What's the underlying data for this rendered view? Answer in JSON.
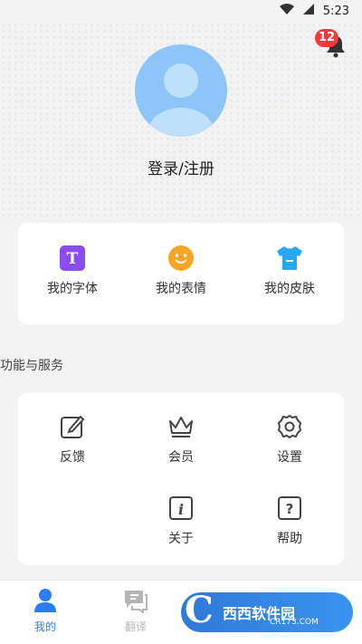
{
  "status_bar": {
    "time": "5:23"
  },
  "header": {
    "notification_count": "12",
    "login_label": "登录/注册"
  },
  "quick_tiles": [
    {
      "label": "我的字体",
      "icon": "font-t-icon",
      "color": "#8b4df2"
    },
    {
      "label": "我的表情",
      "icon": "smiley-icon",
      "color": "#f6a623"
    },
    {
      "label": "我的皮肤",
      "icon": "tshirt-icon",
      "color": "#2aa8f5"
    }
  ],
  "services": {
    "title": "功能与服务",
    "items": [
      {
        "label": "反馈",
        "icon": "edit-icon"
      },
      {
        "label": "会员",
        "icon": "crown-icon"
      },
      {
        "label": "设置",
        "icon": "gear-icon"
      },
      {
        "label": "关于",
        "icon": "info-icon"
      },
      {
        "label": "帮助",
        "icon": "help-icon"
      }
    ]
  },
  "bottom_nav": {
    "items": [
      {
        "label": "我的",
        "active": true
      },
      {
        "label": "翻译",
        "active": false
      }
    ]
  },
  "watermark": {
    "brand": "西西软件园",
    "url": "CR173.COM"
  },
  "colors": {
    "accent": "#2b7df7",
    "badge": "#ef3b3b",
    "avatar": "#8ec5f9"
  }
}
